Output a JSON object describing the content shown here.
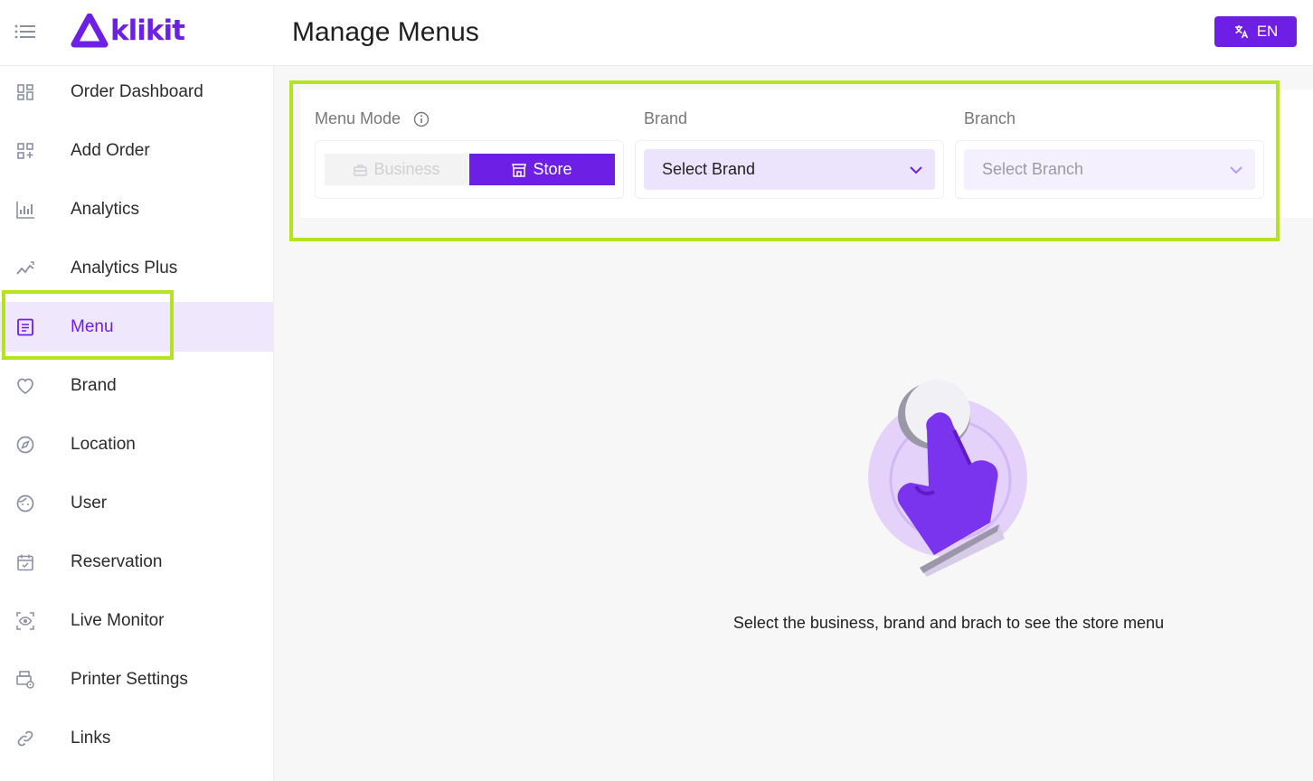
{
  "header": {
    "logo_text": "klikit",
    "page_title": "Manage Menus",
    "language_label": "EN"
  },
  "sidebar": {
    "items": [
      {
        "label": "Order Dashboard",
        "icon": "dashboard-grid-icon"
      },
      {
        "label": "Add Order",
        "icon": "add-grid-icon"
      },
      {
        "label": "Analytics",
        "icon": "bar-chart-icon"
      },
      {
        "label": "Analytics Plus",
        "icon": "trend-line-icon"
      },
      {
        "label": "Menu",
        "icon": "document-list-icon",
        "active": true
      },
      {
        "label": "Brand",
        "icon": "heart-icon"
      },
      {
        "label": "Location",
        "icon": "compass-icon"
      },
      {
        "label": "User",
        "icon": "face-icon"
      },
      {
        "label": "Reservation",
        "icon": "calendar-check-icon"
      },
      {
        "label": "Live Monitor",
        "icon": "monitor-eye-icon"
      },
      {
        "label": "Printer Settings",
        "icon": "printer-gear-icon"
      },
      {
        "label": "Links",
        "icon": "link-icon"
      }
    ]
  },
  "filters": {
    "menu_mode_label": "Menu Mode",
    "brand_label": "Brand",
    "branch_label": "Branch",
    "mode_business_label": "Business",
    "mode_store_label": "Store",
    "selected_mode": "Store",
    "brand_placeholder": "Select Brand",
    "branch_placeholder": "Select Branch"
  },
  "empty_state": {
    "message": "Select the business, brand and brach to see the store menu"
  },
  "colors": {
    "accent": "#6d1fe5",
    "active_bg": "#efe8fc",
    "highlight": "#b6e31f"
  }
}
